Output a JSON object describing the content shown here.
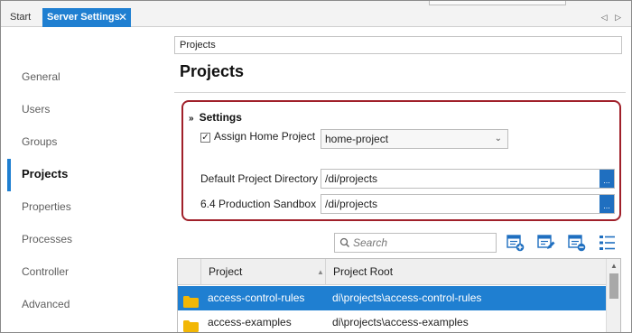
{
  "tabs": [
    {
      "label": "Start",
      "active": false
    },
    {
      "label": "Server Settings",
      "active": true
    }
  ],
  "tab_close_glyph": "✕",
  "tab_nav_glyph": "◁ ▷",
  "sidebar": {
    "items": [
      {
        "label": "General",
        "active": false
      },
      {
        "label": "Users",
        "active": false
      },
      {
        "label": "Groups",
        "active": false
      },
      {
        "label": "Projects",
        "active": true
      },
      {
        "label": "Properties",
        "active": false
      },
      {
        "label": "Processes",
        "active": false
      },
      {
        "label": "Controller",
        "active": false
      },
      {
        "label": "Advanced",
        "active": false
      }
    ]
  },
  "breadcrumb": "Projects",
  "page_title": "Projects",
  "settings": {
    "heading": "Settings",
    "chevron": "»",
    "assign_home": {
      "label": "Assign Home Project",
      "checked": true,
      "check_glyph": "✓"
    },
    "home_project_select": {
      "value": "home-project",
      "caret": "⌄"
    },
    "default_dir": {
      "label": "Default Project Directory",
      "value": "/di/projects",
      "button": "..."
    },
    "sandbox": {
      "label": "6.4 Production Sandbox",
      "value": "/di/projects",
      "button": "..."
    }
  },
  "search": {
    "placeholder": "Search",
    "icon": "search-icon",
    "glyph": "⚲"
  },
  "toolbar_icons": [
    "add-project-icon",
    "edit-project-icon",
    "remove-project-icon",
    "column-list-icon"
  ],
  "grid": {
    "columns": [
      "Project",
      "Project Root"
    ],
    "sort_glyph": "▲",
    "rows": [
      {
        "project": "access-control-rules",
        "root": "di\\projects\\access-control-rules",
        "selected": true
      },
      {
        "project": "access-examples",
        "root": "di\\projects\\access-examples",
        "selected": false
      }
    ],
    "scroll_up_glyph": "▲"
  },
  "colors": {
    "accent": "#1f7fd1",
    "highlight_border": "#a0202a",
    "folder": "#f2b705"
  }
}
